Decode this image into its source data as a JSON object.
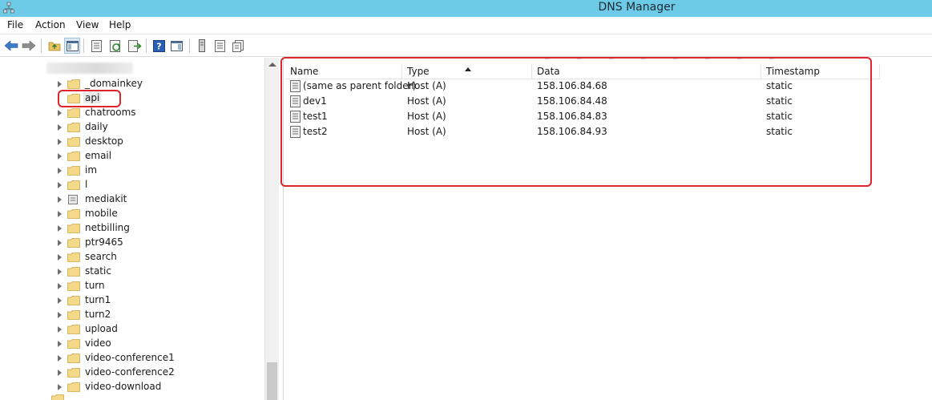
{
  "window": {
    "title": "DNS Manager"
  },
  "menu": [
    "File",
    "Action",
    "View",
    "Help"
  ],
  "toolbar": {
    "buttons": [
      "back-icon",
      "forward-icon",
      "up-folder-icon",
      "show-hide-tree-icon",
      "properties-icon",
      "refresh-icon",
      "export-list-icon",
      "help-icon",
      "show-hide-action-pane-icon",
      "server-icon",
      "zone-icon",
      "records-icon"
    ]
  },
  "tree": {
    "items": [
      {
        "label": "_domainkey"
      },
      {
        "label": "api",
        "selected": true
      },
      {
        "label": "chatrooms"
      },
      {
        "label": "daily"
      },
      {
        "label": "desktop"
      },
      {
        "label": "email"
      },
      {
        "label": "im"
      },
      {
        "label": "l"
      },
      {
        "label": "mediakit",
        "special_icon": true
      },
      {
        "label": "mobile"
      },
      {
        "label": "netbilling"
      },
      {
        "label": "ptr9465"
      },
      {
        "label": "search"
      },
      {
        "label": "static"
      },
      {
        "label": "turn"
      },
      {
        "label": "turn1"
      },
      {
        "label": "turn2"
      },
      {
        "label": "upload"
      },
      {
        "label": "video"
      },
      {
        "label": "video-conference1"
      },
      {
        "label": "video-conference2"
      },
      {
        "label": "video-download"
      }
    ]
  },
  "list": {
    "columns": [
      "Name",
      "Type",
      "Data",
      "Timestamp"
    ],
    "sorted_column": "Type",
    "rows": [
      {
        "name": "(same as parent folder)",
        "type": "Host (A)",
        "data": "158.106.84.68",
        "timestamp": "static"
      },
      {
        "name": "dev1",
        "type": "Host (A)",
        "data": "158.106.84.48",
        "timestamp": "static"
      },
      {
        "name": "test1",
        "type": "Host (A)",
        "data": "158.106.84.83",
        "timestamp": "static"
      },
      {
        "name": "test2",
        "type": "Host (A)",
        "data": "158.106.84.93",
        "timestamp": "static"
      }
    ]
  },
  "colors": {
    "titlebar": "#6dcbe8",
    "highlight": "#e0242c",
    "folder": "#f5d98a"
  }
}
